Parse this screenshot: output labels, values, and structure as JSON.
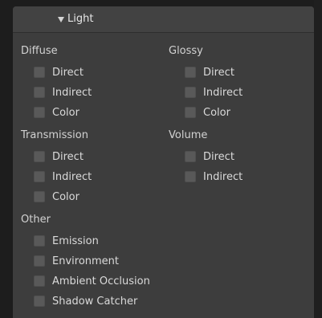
{
  "panel": {
    "title": "Light",
    "expand_icon": "triangle-down-icon"
  },
  "groups": {
    "diffuse": {
      "label": "Diffuse",
      "items": [
        "Direct",
        "Indirect",
        "Color"
      ]
    },
    "glossy": {
      "label": "Glossy",
      "items": [
        "Direct",
        "Indirect",
        "Color"
      ]
    },
    "transmission": {
      "label": "Transmission",
      "items": [
        "Direct",
        "Indirect",
        "Color"
      ]
    },
    "volume": {
      "label": "Volume",
      "items": [
        "Direct",
        "Indirect"
      ]
    },
    "other": {
      "label": "Other",
      "items": [
        "Emission",
        "Environment",
        "Ambient Occlusion",
        "Shadow Catcher"
      ]
    }
  },
  "colors": {
    "panel_bg": "#3d3d3d",
    "header_bg": "#424242",
    "checkbox": "#595959",
    "text": "#d6d6d6"
  }
}
